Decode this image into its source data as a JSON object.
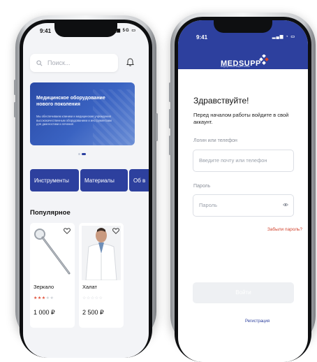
{
  "left_phone": {
    "status": {
      "time": "9:41",
      "network": "5G"
    },
    "search": {
      "placeholder": "Поиск..."
    },
    "banner": {
      "title": "Медицинское оборудование нового поколения",
      "text": "Мы обеспечиваем клиники и медицинские учреждения высококачественным оборудованием и инструментами для диагностики и лечения"
    },
    "categories": [
      "Инструменты",
      "Материалы",
      "Об в"
    ],
    "popular_title": "Популярное",
    "products": [
      {
        "name": "Зеркало",
        "price": "1 000 ₽",
        "rating": 3
      },
      {
        "name": "Халат",
        "price": "2 500 ₽",
        "rating": 0
      }
    ]
  },
  "right_phone": {
    "status": {
      "time": "9:41"
    },
    "logo": {
      "word": "MEDSUPP",
      "tagline": "медицинский маркетплейс"
    },
    "greeting": "Здравствуйте!",
    "lead": "Перед началом работы войдите в свой аккаунт.",
    "login_label": "Логин или телефон",
    "login_placeholder": "Введите почту или телефон",
    "password_label": "Пароль",
    "password_placeholder": "Пароль",
    "forgot": "Забыли пароль?",
    "submit": "Войти",
    "register": "Регистрация"
  },
  "colors": {
    "brand": "#2d409e",
    "accent": "#d2442e",
    "star": "#e0513a"
  }
}
